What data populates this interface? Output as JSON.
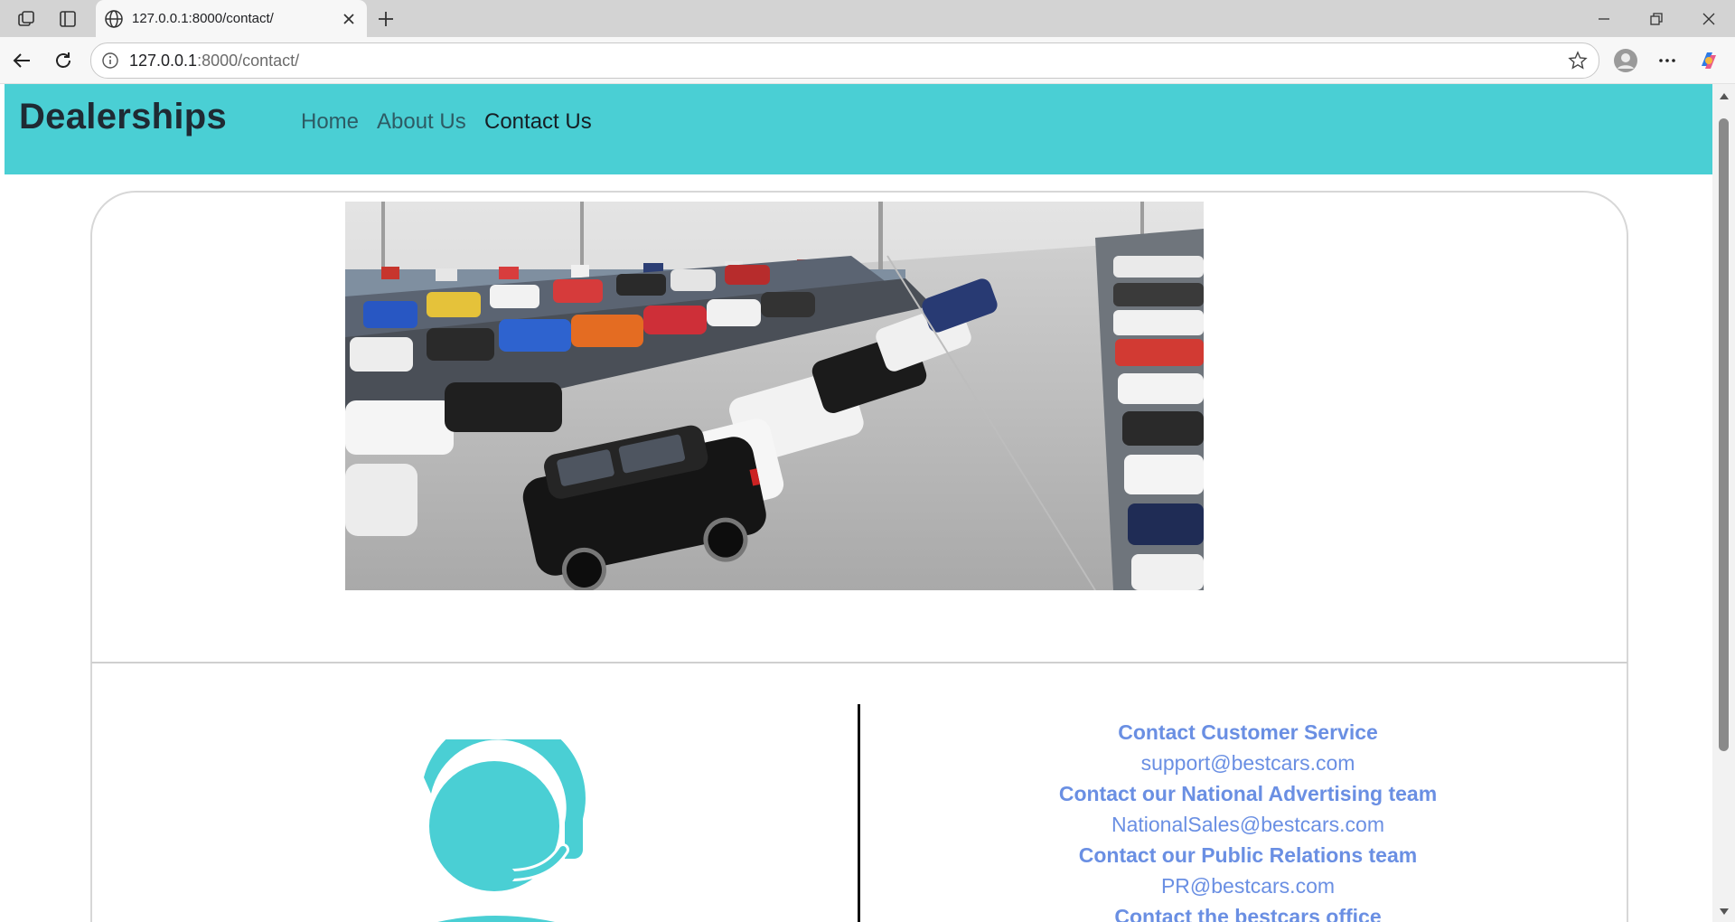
{
  "browser": {
    "tab_title": "127.0.0.1:8000/contact/",
    "url_host": "127.0.0.1",
    "url_rest": ":8000/contact/",
    "icons": {
      "workspaces": "workspaces-icon",
      "tab_actions": "tab-actions-icon",
      "globe": "globe-icon",
      "close_tab": "close-icon",
      "new_tab": "plus-icon",
      "minimize": "minimize-icon",
      "restore": "restore-icon",
      "close_window": "close-icon",
      "back": "back-arrow-icon",
      "refresh": "refresh-icon",
      "site_info": "info-icon",
      "favorite": "star-icon",
      "profile": "profile-icon",
      "menu": "more-icon",
      "copilot": "copilot-icon"
    }
  },
  "navbar": {
    "brand": "Dealerships",
    "links": [
      {
        "label": "Home",
        "active": false
      },
      {
        "label": "About Us",
        "active": false
      },
      {
        "label": "Contact Us",
        "active": true
      }
    ],
    "color": "#4acfd4"
  },
  "contacts": [
    {
      "heading": "Contact Customer Service",
      "email": "support@bestcars.com"
    },
    {
      "heading": "Contact our National Advertising team",
      "email": "NationalSales@bestcars.com"
    },
    {
      "heading": "Contact our Public Relations team",
      "email": "PR@bestcars.com"
    },
    {
      "heading": "Contact the bestcars office",
      "email": ""
    }
  ],
  "colors": {
    "contact_text": "#6a8fe3",
    "support_icon": "#4acfd4"
  }
}
